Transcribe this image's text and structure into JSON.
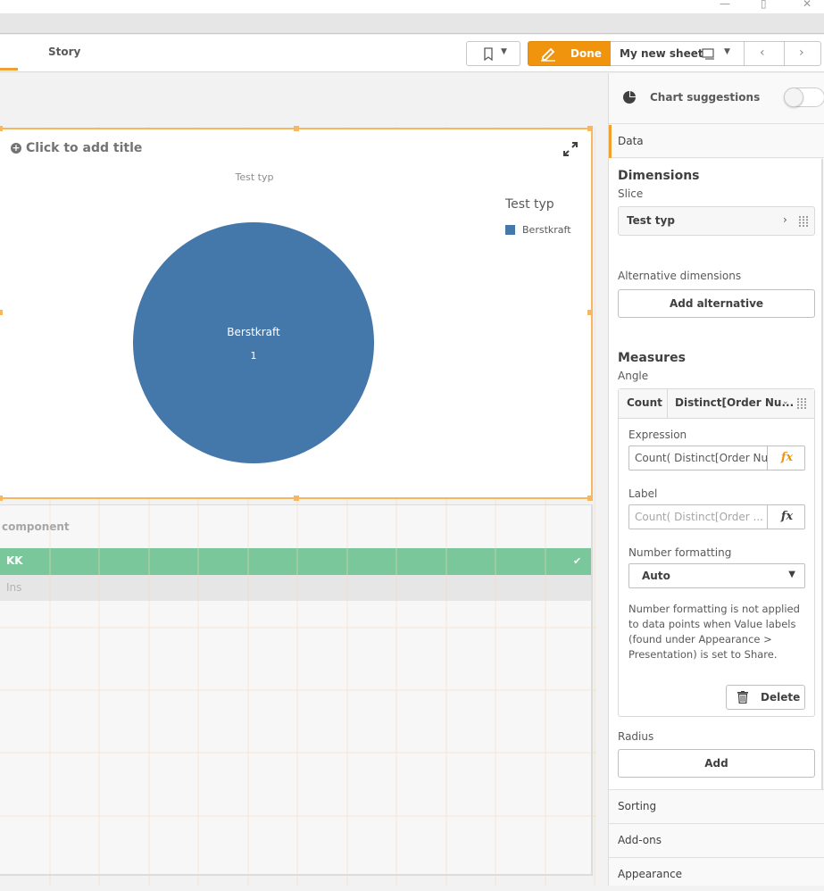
{
  "window": {
    "minimize": "—",
    "restore": "▯",
    "close": "✕"
  },
  "toolbar": {
    "story_tab": "Story",
    "done_label": "Done",
    "sheet_name": "My new sheet",
    "accent_color": "#f0940e"
  },
  "chart": {
    "title_placeholder": "Click to add title",
    "dimension_title": "Test typ",
    "legend_title": "Test typ",
    "legend_items": [
      {
        "label": "Berstkraft",
        "color": "#4477aa"
      }
    ],
    "slice_label": "Berstkraft",
    "slice_value": "1"
  },
  "chart_data": {
    "type": "pie",
    "title": "Test typ",
    "categories": [
      "Berstkraft"
    ],
    "values": [
      1
    ],
    "colors": [
      "#4477aa"
    ],
    "legend_title": "Test typ",
    "legend": "right"
  },
  "filter_pane": {
    "title": "component",
    "items": [
      {
        "label": "KK",
        "state": "selected"
      },
      {
        "label": "Ins",
        "state": "excluded"
      }
    ],
    "selected_color": "#7ac79b"
  },
  "panel": {
    "chart_suggestions": "Chart suggestions",
    "data_tab": "Data",
    "dimensions_heading": "Dimensions",
    "slice_label": "Slice",
    "dimension_item": "Test typ",
    "alt_dimensions_label": "Alternative dimensions",
    "add_alternative": "Add alternative",
    "measures_heading": "Measures",
    "angle_label": "Angle",
    "measure_agg": "Count",
    "measure_field": "Distinct[Order Nu...",
    "expression_label": "Expression",
    "expression_value": "Count( Distinct[Order Nu",
    "label_label": "Label",
    "label_placeholder": "Count( Distinct[Order ...",
    "number_formatting_label": "Number formatting",
    "number_formatting_value": "Auto",
    "number_formatting_note": "Number formatting is not applied to data points when Value labels (found under Appearance > Presentation) is set to Share.",
    "delete_label": "Delete",
    "radius_label": "Radius",
    "add_label": "Add",
    "sections": [
      "Sorting",
      "Add-ons",
      "Appearance"
    ]
  }
}
